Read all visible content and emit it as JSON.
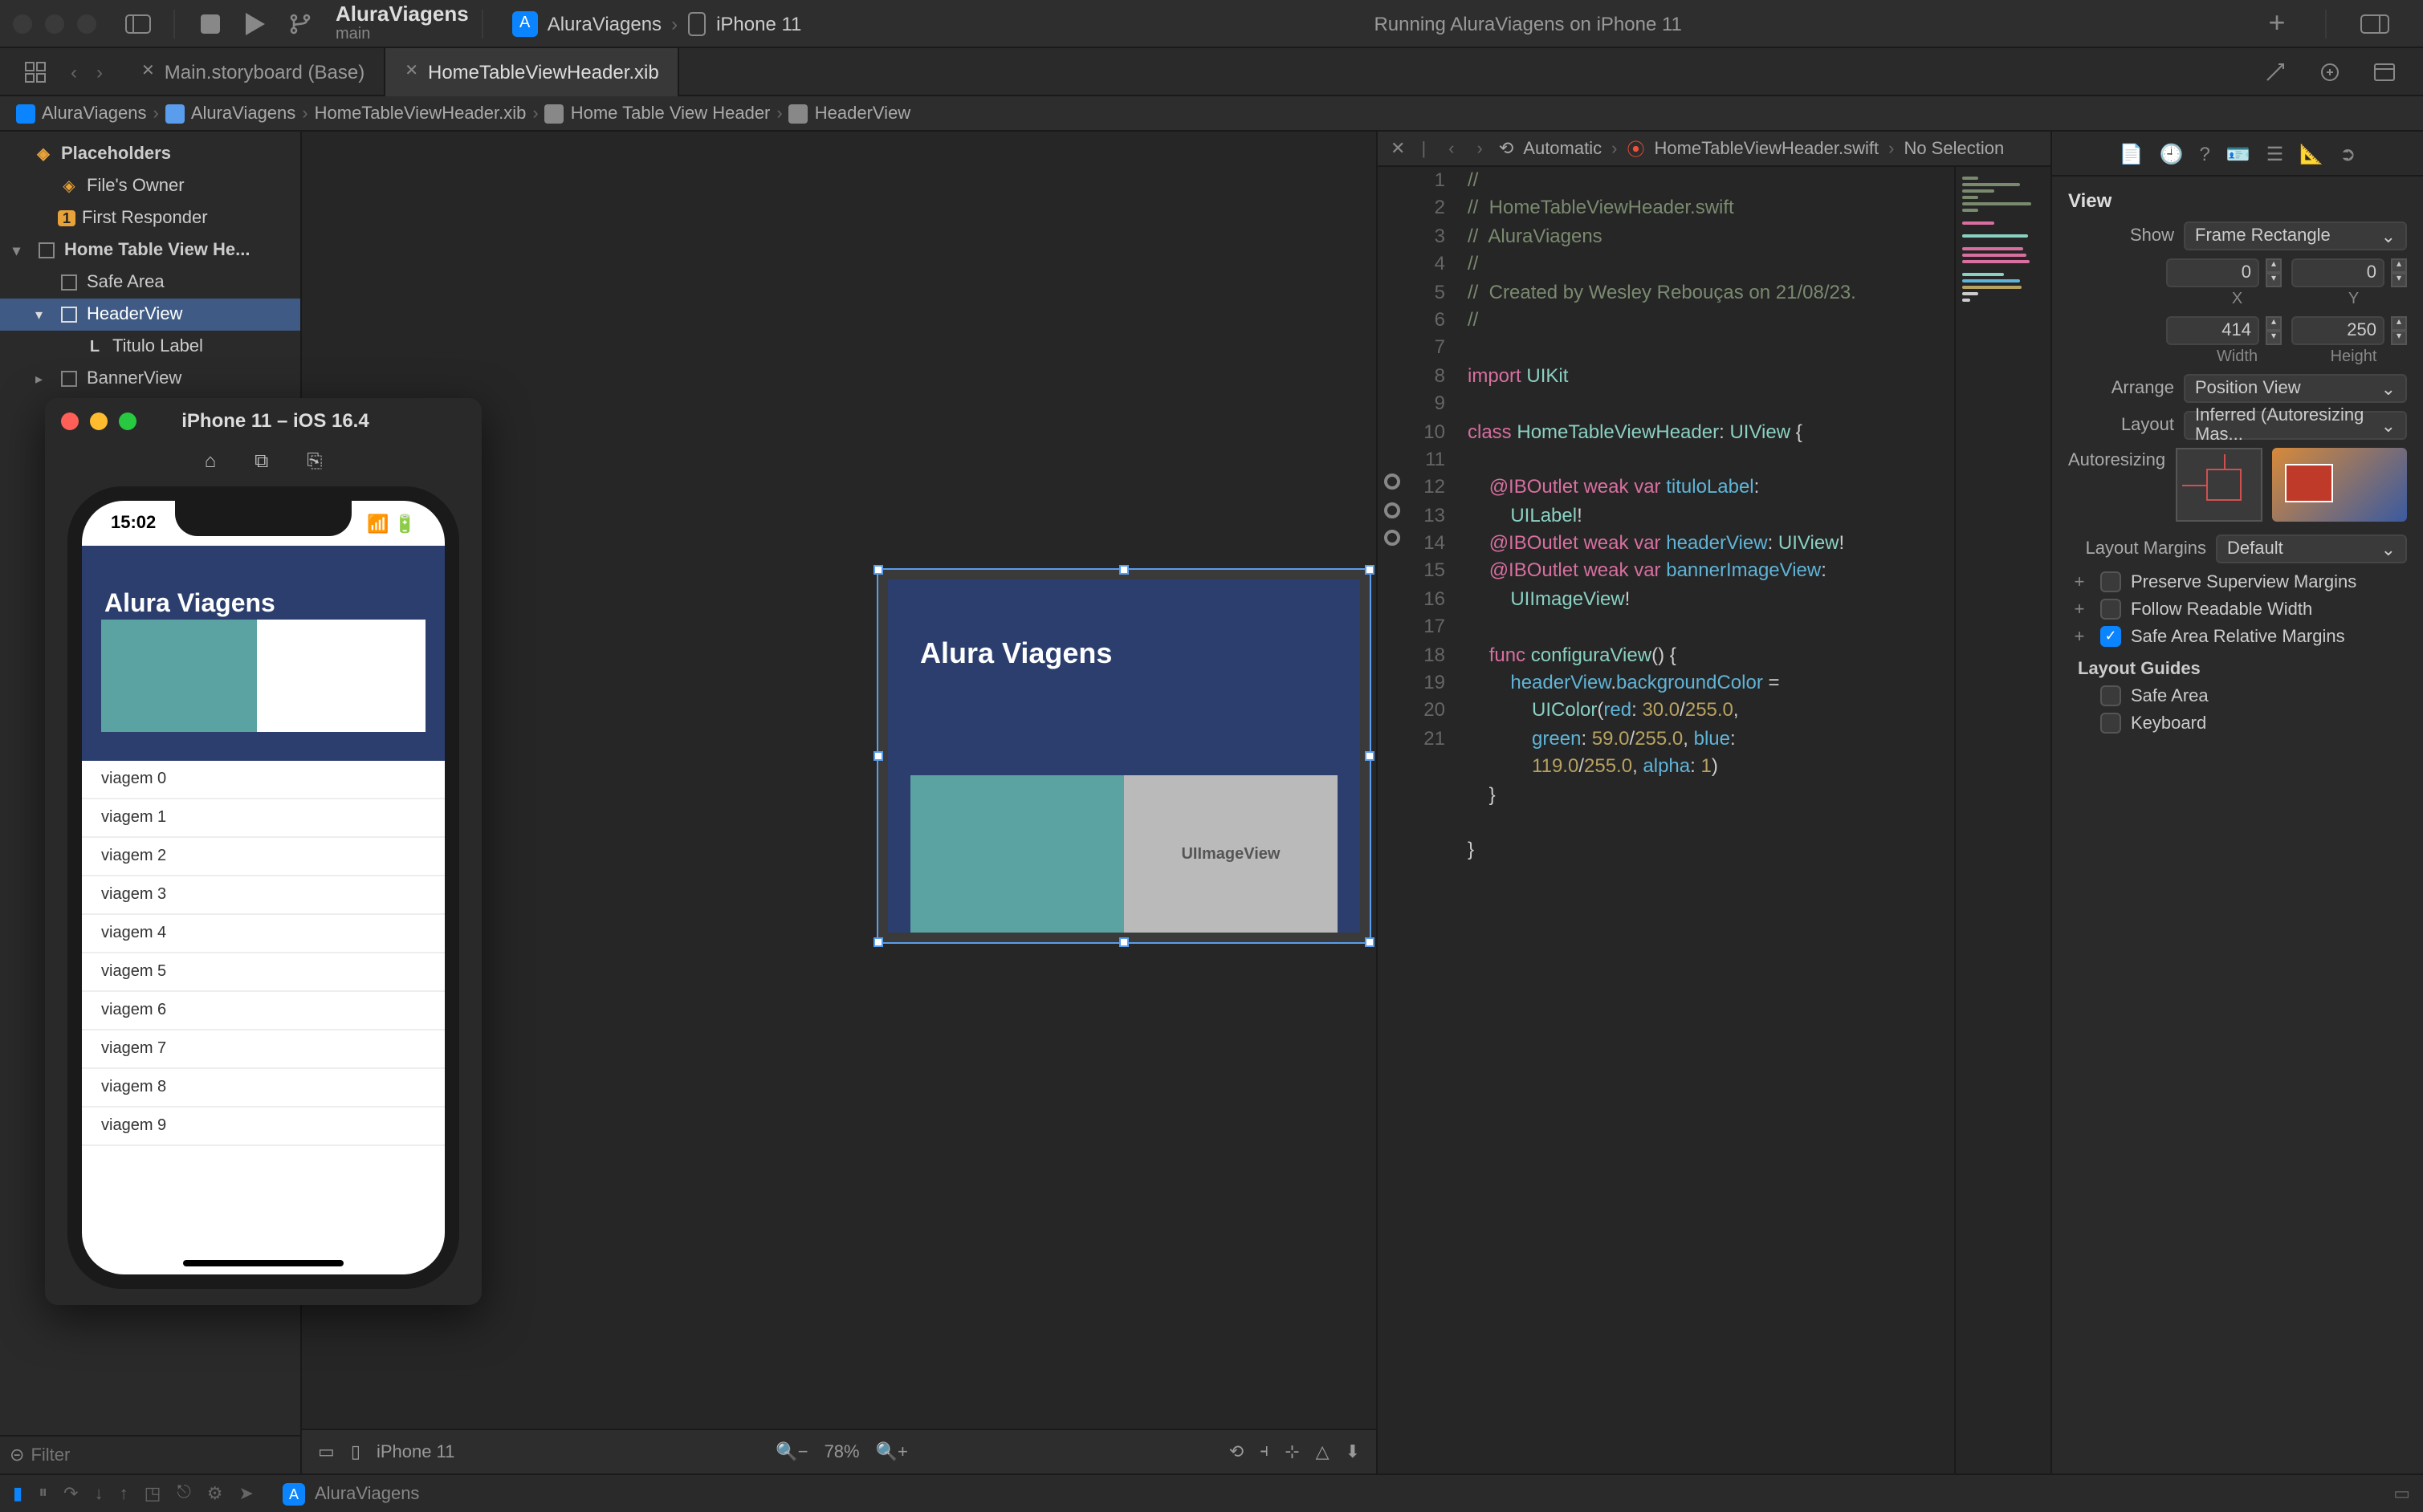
{
  "titlebar": {
    "project_name": "AluraViagens",
    "branch": "main",
    "scheme_app": "AluraViagens",
    "scheme_device": "iPhone 11",
    "status": "Running AluraViagens on iPhone 11"
  },
  "tabs": {
    "storyboard": "Main.storyboard (Base)",
    "xib": "HomeTableViewHeader.xib"
  },
  "breadcrumb": {
    "proj": "AluraViagens",
    "group": "AluraViagens",
    "file": "HomeTableViewHeader.xib",
    "obj": "Home Table View Header",
    "sub": "HeaderView"
  },
  "navigator": {
    "placeholders": "Placeholders",
    "files_owner": "File's Owner",
    "first_responder": "First Responder",
    "root": "Home Table View He...",
    "safe_area": "Safe Area",
    "header_view": "HeaderView",
    "titulo_label": "Titulo Label",
    "banner_view": "BannerView",
    "filter_placeholder": "Filter"
  },
  "canvas": {
    "title": "Alura Viagens",
    "imageview_label": "UIImageView",
    "device": "iPhone 11",
    "zoom": "78%"
  },
  "editor": {
    "jumpbar_auto": "Automatic",
    "jumpbar_file": "HomeTableViewHeader.swift",
    "jumpbar_sel": "No Selection",
    "lines": [
      "//",
      "//  HomeTableViewHeader.swift",
      "//  AluraViagens",
      "//",
      "//  Created by Wesley Rebouças on 21/08/23.",
      "//",
      "",
      "import UIKit",
      "",
      "class HomeTableViewHeader: UIView {",
      "    ",
      "    @IBOutlet weak var tituloLabel: UILabel!",
      "    @IBOutlet weak var headerView: UIView!",
      "    @IBOutlet weak var bannerImageView: UIImageView!",
      "    ",
      "    func configuraView() {",
      "        headerView.backgroundColor = UIColor(red: 30.0/255.0, green: 59.0/255.0, blue: 119.0/255.0, alpha: 1)",
      "    }",
      "",
      "}",
      ""
    ]
  },
  "inspector": {
    "title": "View",
    "show_label": "Show",
    "show_value": "Frame Rectangle",
    "x_label": "X",
    "x_value": "0",
    "y_label": "Y",
    "y_value": "0",
    "width_label": "Width",
    "width_value": "414",
    "height_label": "Height",
    "height_value": "250",
    "arrange_label": "Arrange",
    "arrange_value": "Position View",
    "layout_label": "Layout",
    "layout_value": "Inferred (Autoresizing Mas...",
    "autoresizing_label": "Autoresizing",
    "margins_label": "Layout Margins",
    "margins_value": "Default",
    "preserve_superview": "Preserve Superview Margins",
    "follow_readable": "Follow Readable Width",
    "safe_area_relative": "Safe Area Relative Margins",
    "layout_guides": "Layout Guides",
    "guide_safe_area": "Safe Area",
    "guide_keyboard": "Keyboard"
  },
  "simulator": {
    "title": "iPhone 11 – iOS 16.4",
    "clock": "15:02",
    "header_title": "Alura Viagens",
    "rows": [
      "viagem 0",
      "viagem 1",
      "viagem 2",
      "viagem 3",
      "viagem 4",
      "viagem 5",
      "viagem 6",
      "viagem 7",
      "viagem 8",
      "viagem 9"
    ]
  },
  "debugbar": {
    "target": "AluraViagens"
  }
}
